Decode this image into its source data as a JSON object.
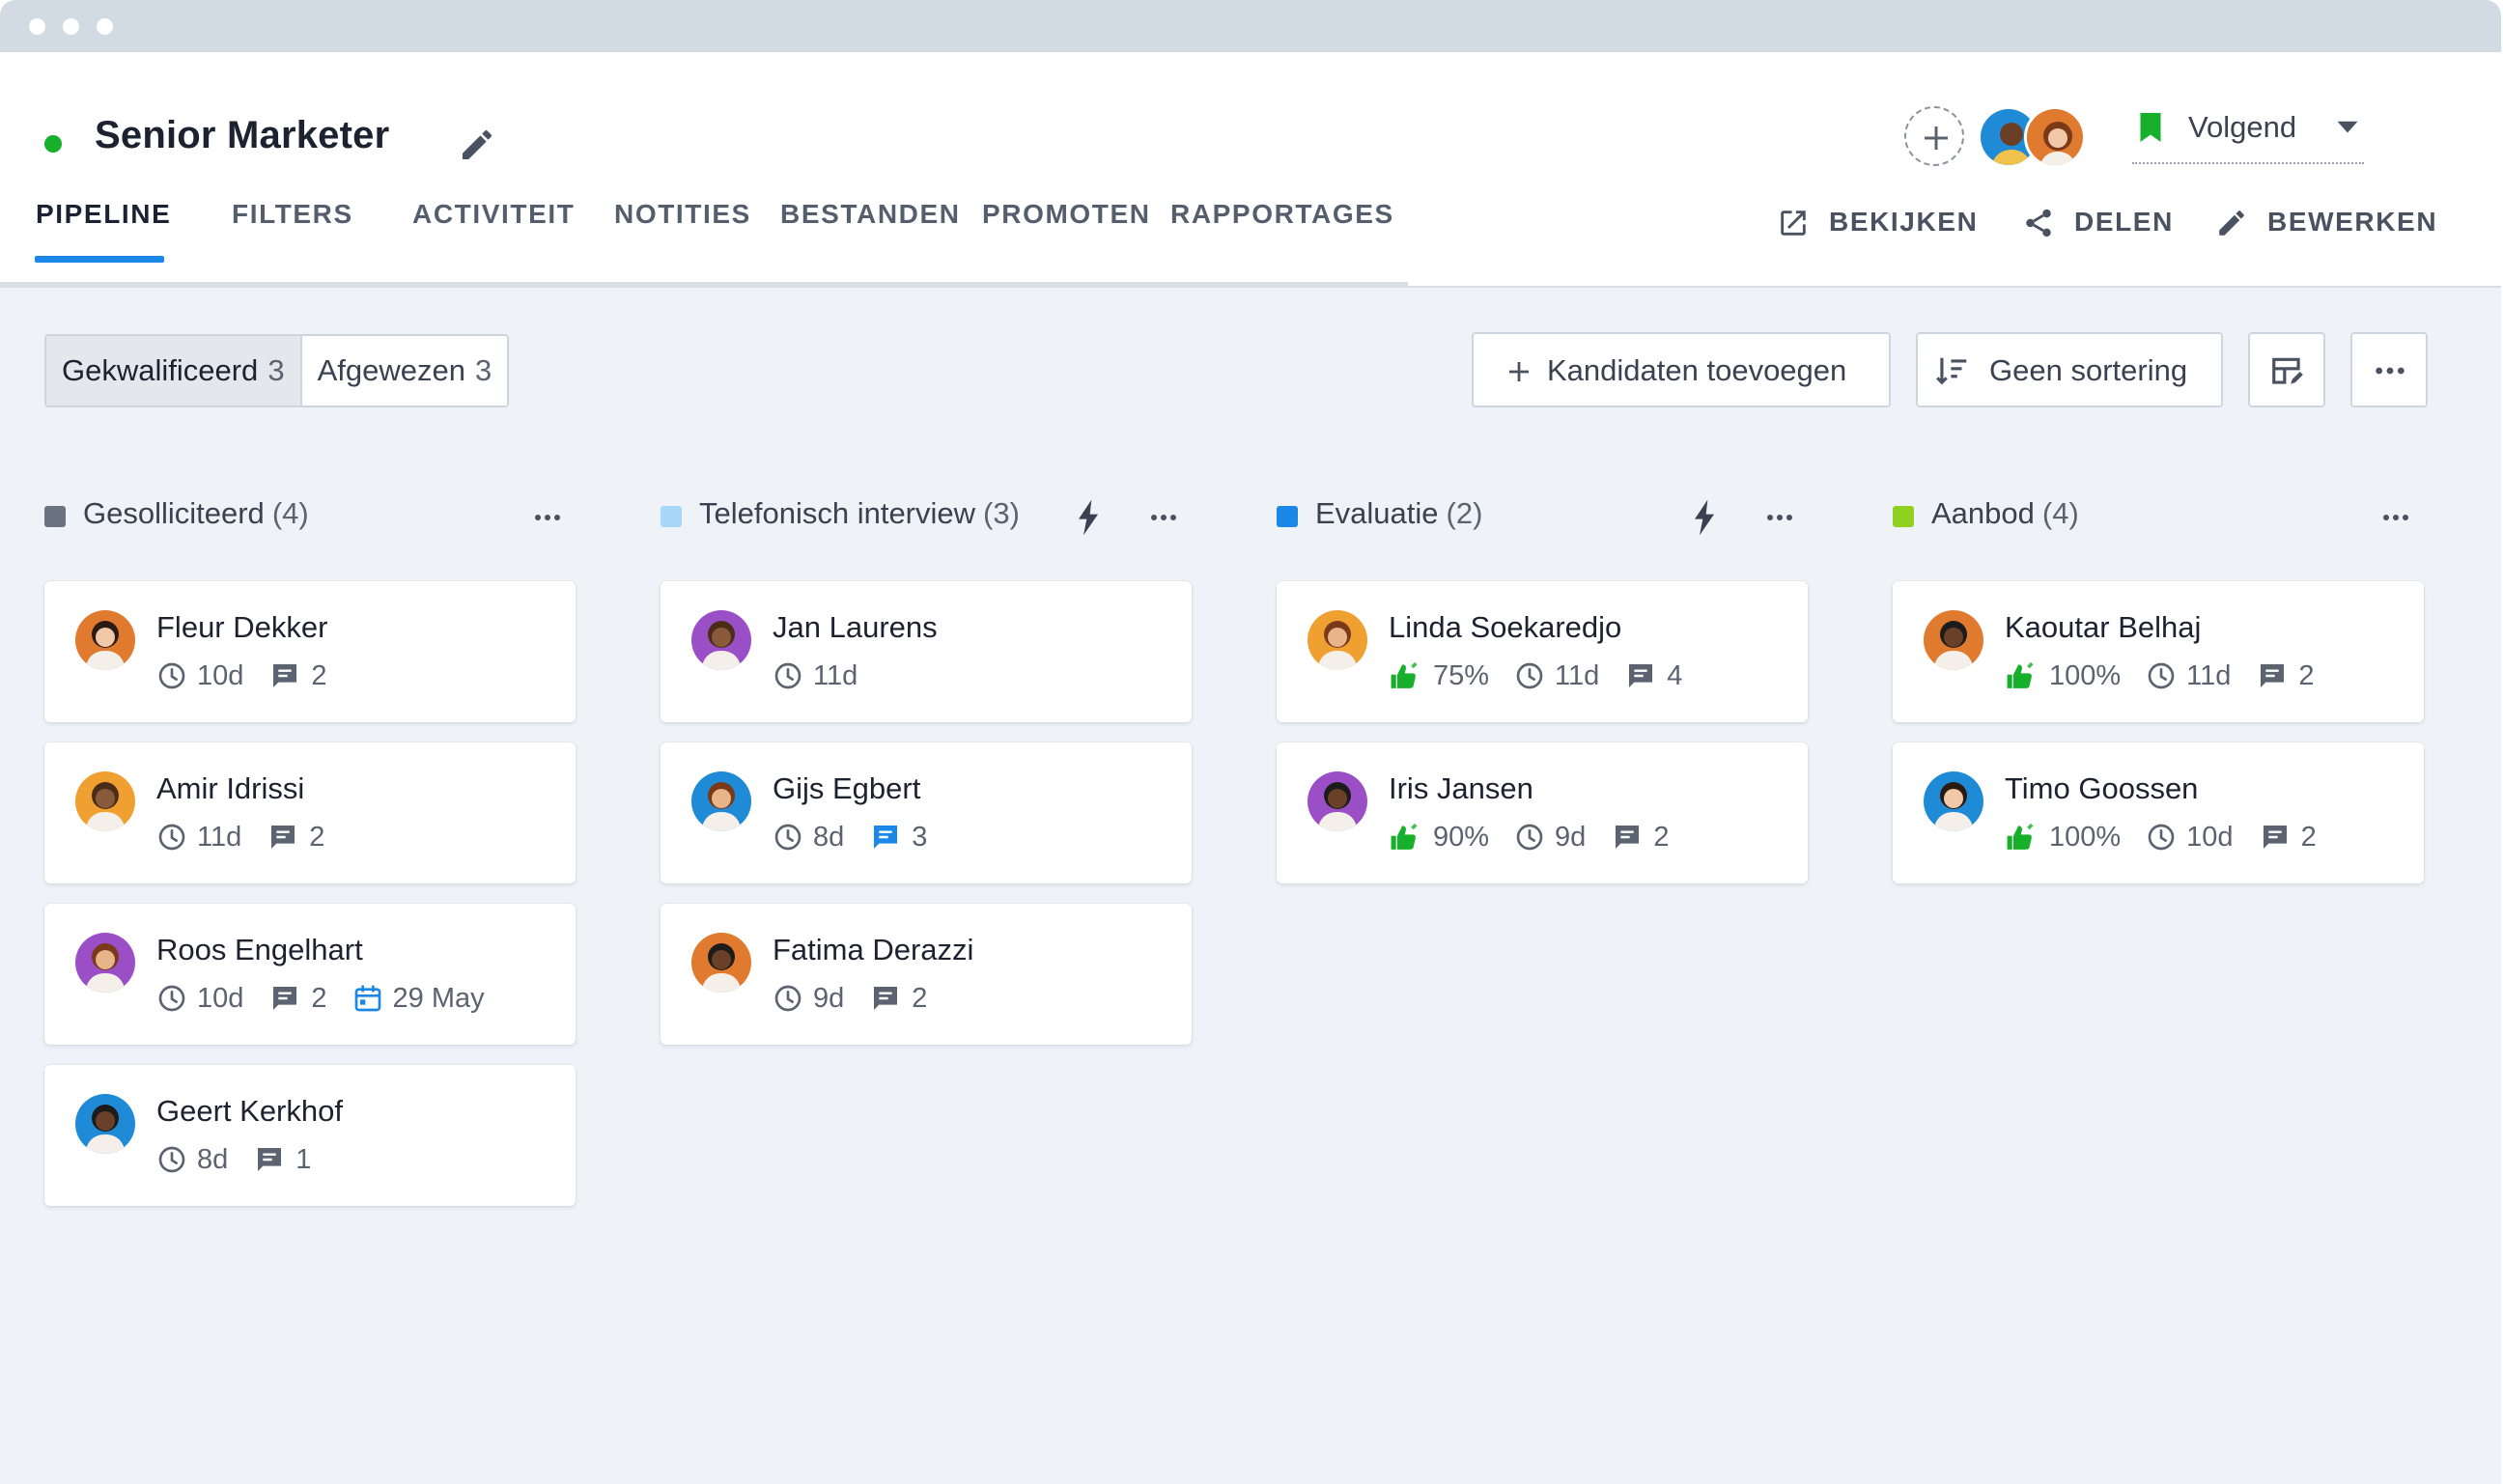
{
  "job": {
    "title": "Senior Marketer",
    "status_color": "#17b02a"
  },
  "tabs": [
    {
      "label": "PIPELINE",
      "active": true
    },
    {
      "label": "FILTERS"
    },
    {
      "label": "ACTIVITEIT"
    },
    {
      "label": "NOTITIES"
    },
    {
      "label": "BESTANDEN"
    },
    {
      "label": "PROMOTEN"
    },
    {
      "label": "RAPPORTAGES"
    }
  ],
  "header": {
    "follow_label": "Volgend",
    "actions": [
      {
        "label": "BEKIJKEN",
        "icon": "external-link-icon"
      },
      {
        "label": "DELEN",
        "icon": "share-icon"
      },
      {
        "label": "BEWERKEN",
        "icon": "pencil-icon"
      }
    ]
  },
  "toolbar": {
    "segments": [
      {
        "label": "Gekwalificeerd",
        "count": "3",
        "active": true
      },
      {
        "label": "Afgewezen",
        "count": "3"
      }
    ],
    "add_candidates_label": "Kandidaten toevoegen",
    "sort_label": "Geen sortering"
  },
  "colors": {
    "accent": "#1b87e6",
    "board_bg": "#eff3f7",
    "score_green": "#17b02a",
    "date_blue": "#1b87e6"
  },
  "columns": [
    {
      "title": "Gesolliciteerd",
      "count": "(4)",
      "color": "#6b7280",
      "automation": false,
      "cards": [
        {
          "name": "Fleur Dekker",
          "days": "10d",
          "comments": "2",
          "avatar_color": "#e07a2e"
        },
        {
          "name": "Amir Idrissi",
          "days": "11d",
          "comments": "2",
          "avatar_color": "#f0a030"
        },
        {
          "name": "Roos Engelhart",
          "days": "10d",
          "comments": "2",
          "date": "29 May",
          "avatar_color": "#9b4fc7"
        },
        {
          "name": "Geert Kerkhof",
          "days": "8d",
          "comments": "1",
          "avatar_color": "#1f8ad6"
        }
      ]
    },
    {
      "title": "Telefonisch interview",
      "count": "(3)",
      "color": "#a8d8f8",
      "automation": true,
      "cards": [
        {
          "name": "Jan Laurens",
          "days": "11d",
          "avatar_color": "#9b4fc7"
        },
        {
          "name": "Gijs Egbert",
          "days": "8d",
          "comments": "3",
          "comments_highlight": true,
          "avatar_color": "#1f8ad6"
        },
        {
          "name": "Fatima Derazzi",
          "days": "9d",
          "comments": "2",
          "avatar_color": "#e07a2e"
        }
      ]
    },
    {
      "title": "Evaluatie",
      "count": "(2)",
      "color": "#1b87e6",
      "automation": true,
      "cards": [
        {
          "name": "Linda Soekaredjo",
          "score": "75%",
          "days": "11d",
          "comments": "4",
          "avatar_color": "#f0a030"
        },
        {
          "name": "Iris Jansen",
          "score": "90%",
          "days": "9d",
          "comments": "2",
          "avatar_color": "#9b4fc7"
        }
      ]
    },
    {
      "title": "Aanbod",
      "count": "(4)",
      "color": "#8fd11e",
      "automation": false,
      "cards": [
        {
          "name": "Kaoutar Belhaj",
          "score": "100%",
          "days": "11d",
          "comments": "2",
          "avatar_color": "#e07a2e"
        },
        {
          "name": "Timo Goossen",
          "score": "100%",
          "days": "10d",
          "comments": "2",
          "avatar_color": "#1f8ad6"
        }
      ]
    }
  ]
}
